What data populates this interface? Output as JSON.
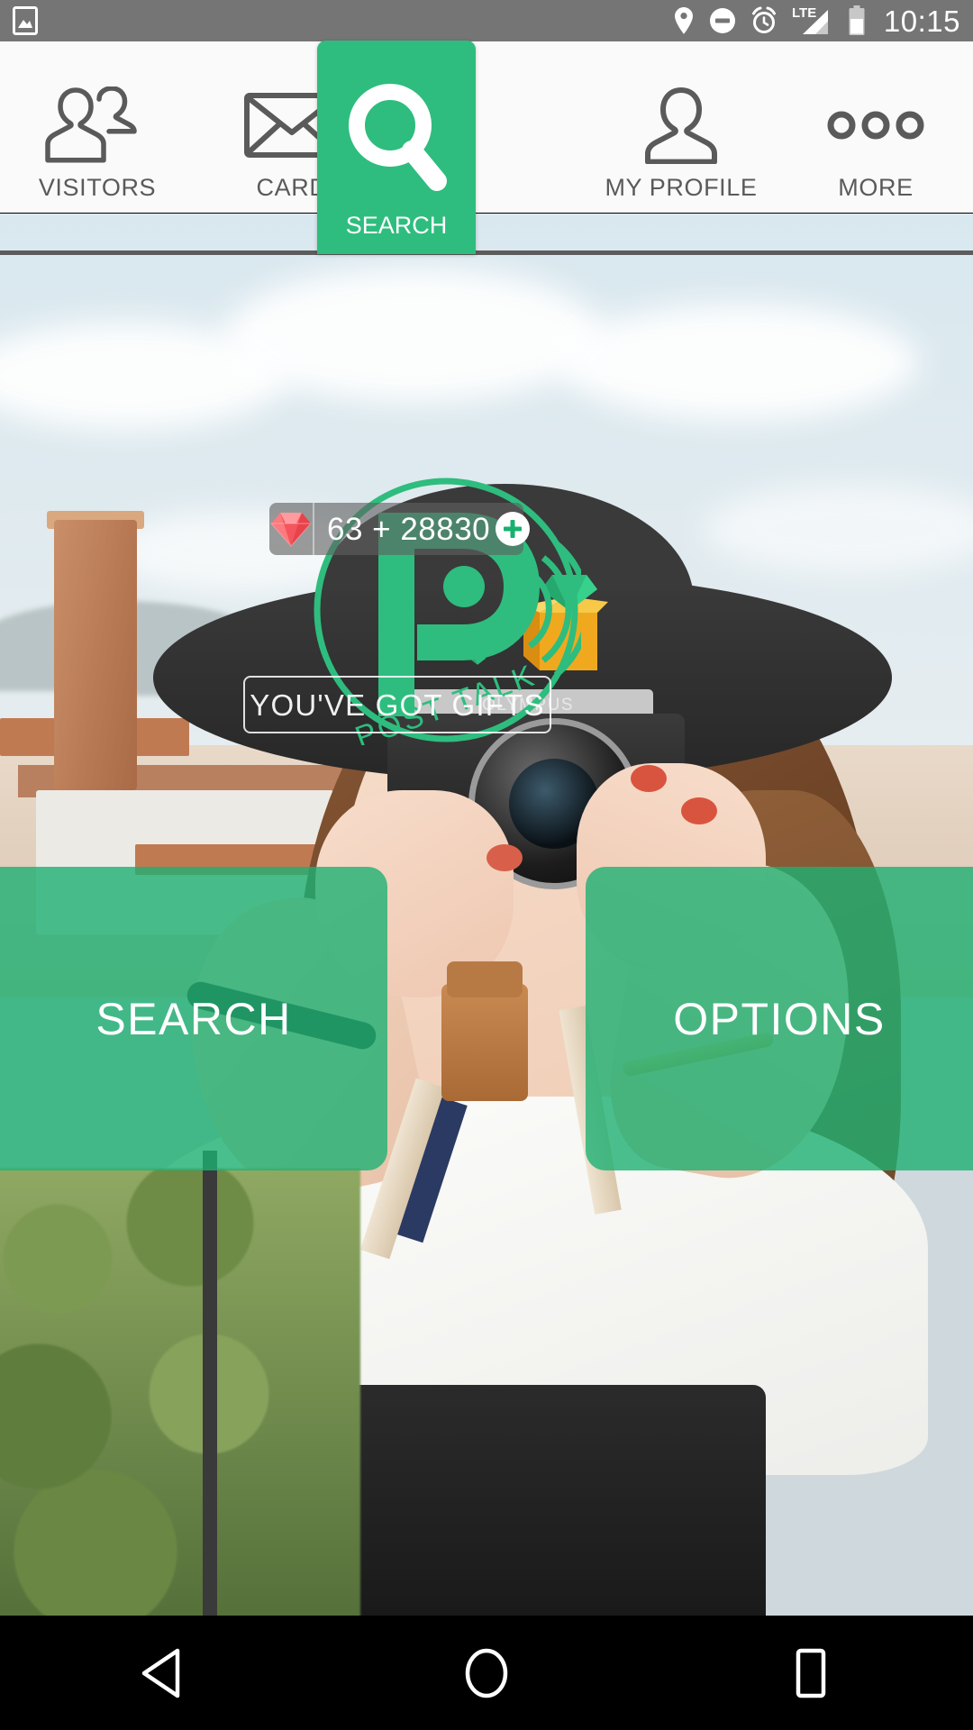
{
  "status_bar": {
    "time": "10:15",
    "left_icons": [
      "image-icon"
    ],
    "right_icons": [
      "location-icon",
      "do-not-disturb-icon",
      "alarm-icon",
      "lte-signal-icon",
      "battery-icon"
    ],
    "network_label": "LTE",
    "background": "#757575"
  },
  "tab_bar": {
    "background": "#fafafa",
    "active_color": "#2ebd7e",
    "inactive_color": "#5a5a5a",
    "tabs": [
      {
        "label": "VISITORS",
        "icon": "two-people-icon",
        "active": false
      },
      {
        "label": "CARD",
        "icon": "envelope-icon",
        "active": false
      },
      {
        "label": "SEARCH",
        "icon": "magnifier-icon",
        "active": true
      },
      {
        "label": "MY PROFILE",
        "icon": "person-icon",
        "active": false
      },
      {
        "label": "MORE",
        "icon": "three-dots-icon",
        "active": false
      }
    ]
  },
  "gem_badge": {
    "icon": "red-diamond-icon",
    "count_text": "63 + 28830",
    "add_button": "plus-icon",
    "add_button_color": "#19b06f"
  },
  "brand": {
    "logo_letter": "P",
    "wordmark": "POST TALK",
    "color": "#2ebd7e",
    "gift_box": "gift-box-icon",
    "gems": "green-gem-icon"
  },
  "gifts_button": {
    "label": "YOU'VE GOT GIFTS"
  },
  "action_buttons": [
    {
      "label": "SEARCH"
    },
    {
      "label": "OPTIONS"
    }
  ],
  "nav_bar": {
    "background": "#000000",
    "buttons": [
      {
        "name": "back",
        "icon": "back-triangle-icon"
      },
      {
        "name": "home",
        "icon": "home-circle-icon"
      },
      {
        "name": "recents",
        "icon": "recents-square-icon"
      }
    ]
  }
}
